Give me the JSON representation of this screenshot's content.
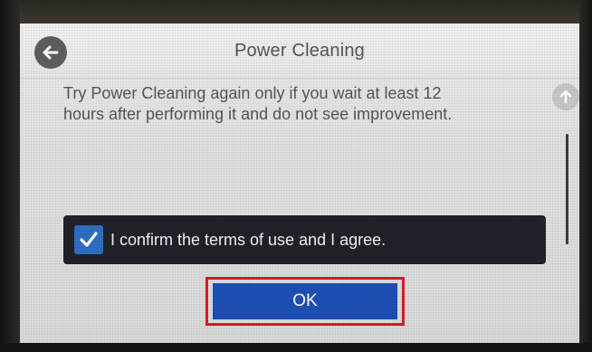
{
  "header": {
    "title": "Power Cleaning",
    "back_icon": "arrow-left-icon"
  },
  "message": {
    "line1": "Try Power Cleaning again only if you wait at least 12",
    "line2": "hours after performing it and do not see improvement."
  },
  "scroll": {
    "up_icon": "arrow-up-icon"
  },
  "confirm": {
    "label": "I confirm the terms of use and I agree.",
    "checked": true,
    "check_icon": "checkmark-icon"
  },
  "ok_button": {
    "label": "OK"
  },
  "colors": {
    "ok_button": "#1f4fb6",
    "highlight": "#d21f2a",
    "checkbox": "#2d6fc3",
    "confirm_bar": "#1f2228"
  }
}
